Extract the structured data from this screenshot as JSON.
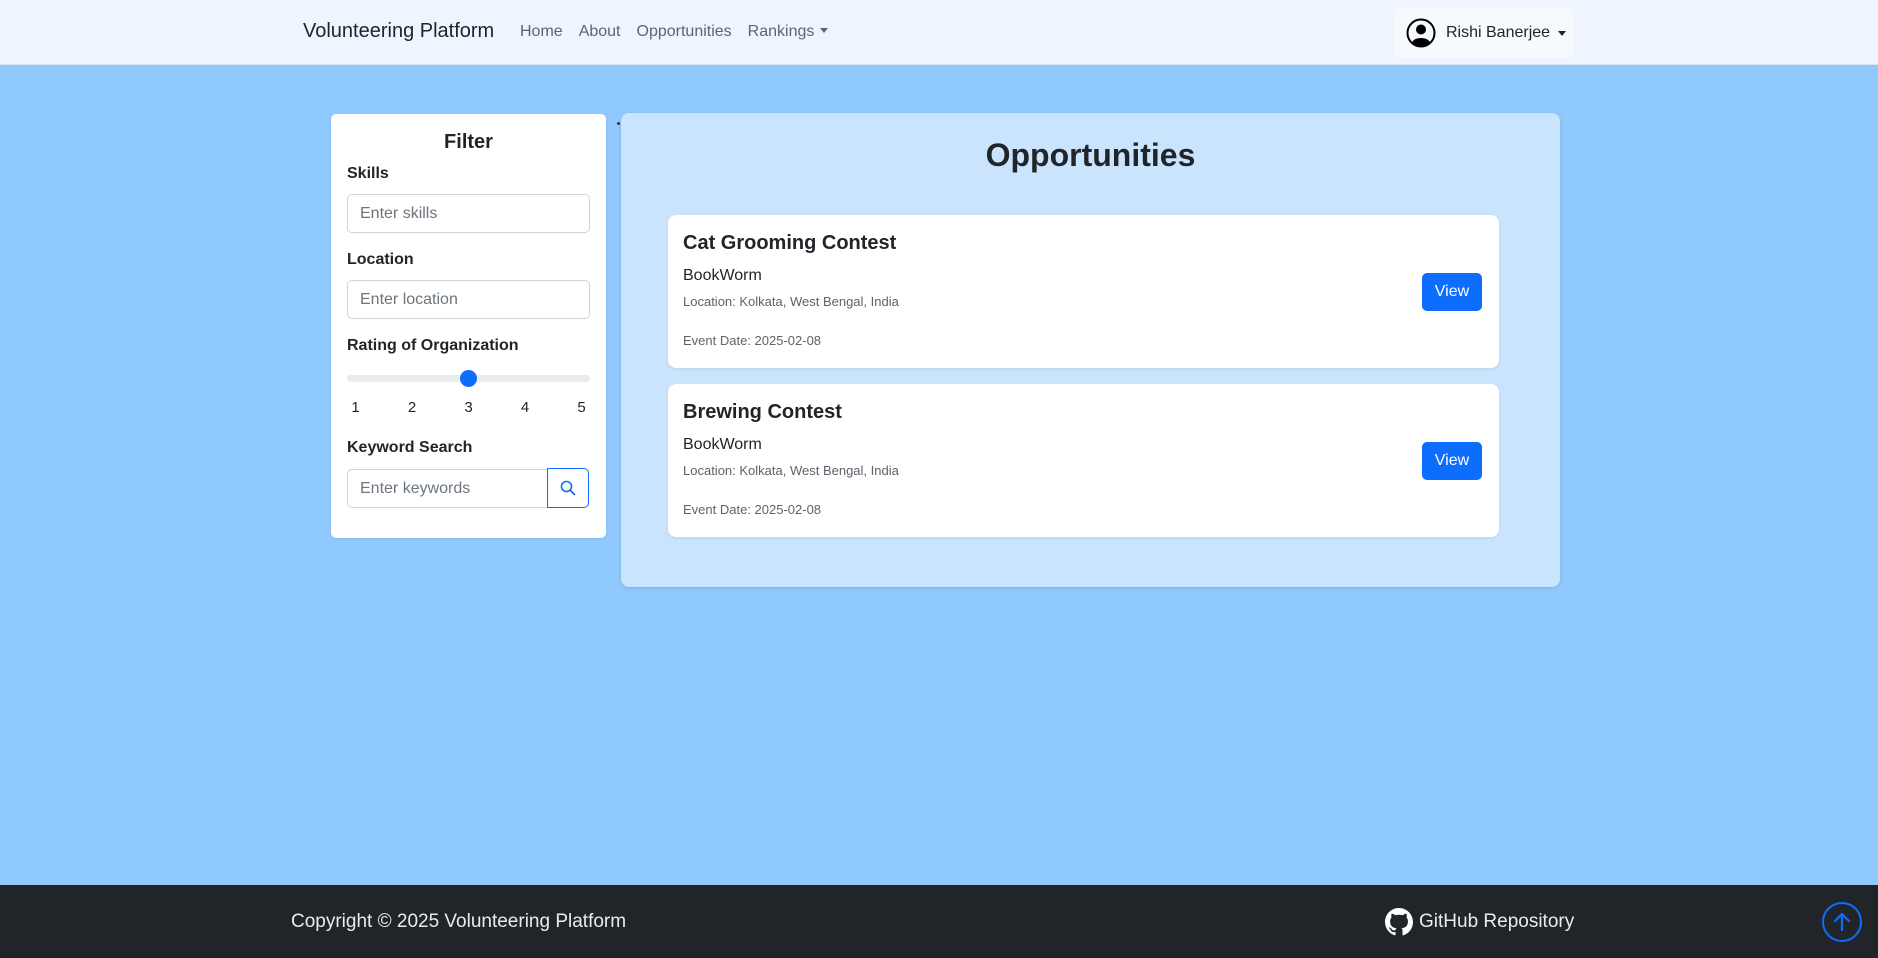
{
  "navbar": {
    "brand": "Volunteering Platform",
    "links": [
      {
        "label": "Home"
      },
      {
        "label": "About"
      },
      {
        "label": "Opportunities"
      },
      {
        "label": "Rankings"
      }
    ],
    "user": {
      "name": "Rishi Banerjee",
      "icon": "user-circle-icon"
    }
  },
  "filter": {
    "title": "Filter",
    "skills": {
      "label": "Skills",
      "placeholder": "Enter skills"
    },
    "location": {
      "label": "Location",
      "placeholder": "Enter location"
    },
    "rating": {
      "label": "Rating of Organization",
      "min": 1,
      "max": 5,
      "value": 3,
      "ticks": [
        "1",
        "2",
        "3",
        "4",
        "5"
      ]
    },
    "keyword": {
      "label": "Keyword Search",
      "placeholder": "Enter keywords",
      "icon": "search-icon"
    }
  },
  "main": {
    "title": "Opportunities",
    "opportunities": [
      {
        "title": "Cat Grooming Contest",
        "organization": "BookWorm",
        "location": "Location: Kolkata, West Bengal, India",
        "date": "Event Date: 2025-02-08",
        "button": "View"
      },
      {
        "title": "Brewing Contest",
        "organization": "BookWorm",
        "location": "Location: Kolkata, West Bengal, India",
        "date": "Event Date: 2025-02-08",
        "button": "View"
      }
    ]
  },
  "footer": {
    "copyright": "Copyright © 2025 Volunteering Platform",
    "github": {
      "label": "GitHub Repository",
      "icon": "github-icon"
    },
    "scroll_top_icon": "arrow-up-circle-icon"
  },
  "colors": {
    "page_bg": "#90c9fd",
    "panel_bg": "#cae4fd",
    "navbar_bg": "#eef5ff",
    "primary": "#0d6efd",
    "footer_bg": "#212529"
  }
}
